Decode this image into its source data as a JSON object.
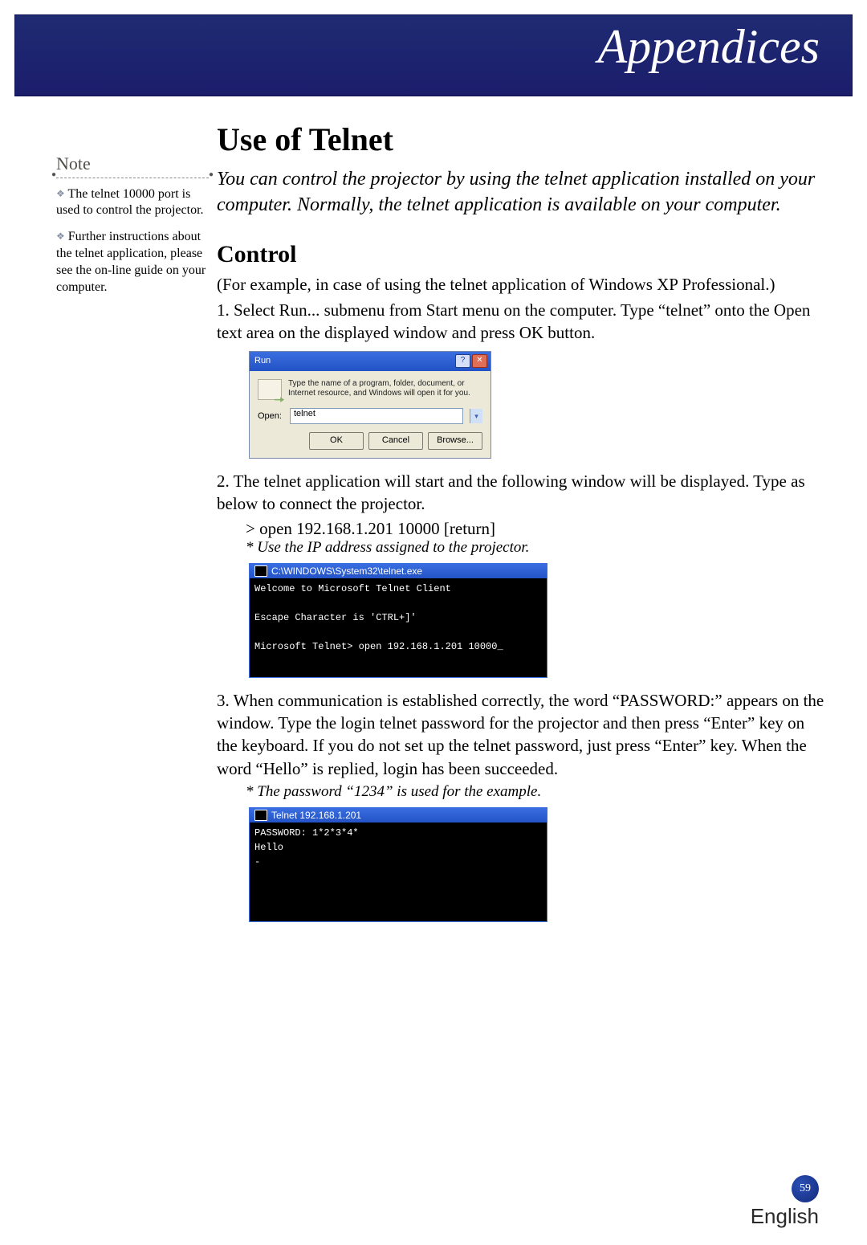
{
  "header": {
    "title": "Appendices"
  },
  "sidebar": {
    "note_label": "Note",
    "items": [
      "The telnet 10000 port is used to control the projector.",
      "Further instructions about the telnet application, please see the on-line guide on your computer."
    ]
  },
  "main": {
    "h1": "Use of Telnet",
    "intro": "You can control the projector by using the telnet application installed on your computer. Normally, the telnet application is available on your computer.",
    "h2": "Control",
    "p0": "(For example, in case of using the telnet application of Windows XP Professional.)",
    "step1": "1. Select Run... submenu from Start menu on the computer. Type “telnet” onto the Open text area on the displayed window and press OK button.",
    "step2": "2. The telnet application will start and the following window will be displayed. Type as below to connect the projector.",
    "cmd2": "> open 192.168.1.201 10000 [return]",
    "note2": "* Use the IP address assigned to the projector.",
    "step3": "3. When communication is established correctly, the word “PASSWORD:” appears on the window. Type the login telnet password for the projector and then press “Enter” key on the keyboard. If you do not set up the telnet password, just press “Enter” key. When the word “Hello” is replied, login has been succeeded.",
    "note3": "* The password “1234” is used for the example."
  },
  "run_dialog": {
    "title": "Run",
    "desc": "Type the name of a program, folder, document, or Internet resource, and Windows will open it for you.",
    "open_label": "Open:",
    "value": "telnet",
    "ok": "OK",
    "cancel": "Cancel",
    "browse": "Browse..."
  },
  "term1": {
    "title": "C:\\WINDOWS\\System32\\telnet.exe",
    "lines": "Welcome to Microsoft Telnet Client\n\nEscape Character is 'CTRL+]'\n\nMicrosoft Telnet> open 192.168.1.201 10000_"
  },
  "term2": {
    "title": "Telnet 192.168.1.201",
    "lines": "PASSWORD: 1*2*3*4*\nHello\n-"
  },
  "footer": {
    "page": "59",
    "lang": "English"
  }
}
